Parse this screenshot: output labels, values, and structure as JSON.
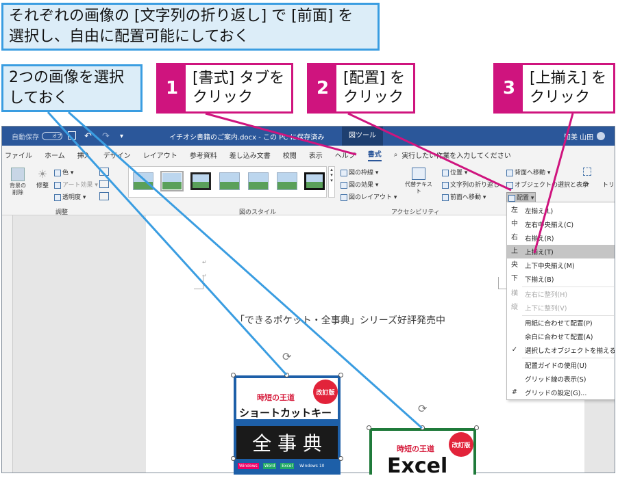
{
  "callouts": {
    "top": {
      "line1": "それぞれの画像の [文字列の折り返し] で [前面] を",
      "line2": "選択し、自由に配置可能にしておく"
    },
    "left": {
      "line1": "2つの画像を選択",
      "line2": "しておく"
    }
  },
  "steps": [
    {
      "num": "1",
      "line1": "[書式] タブを",
      "line2": "クリック"
    },
    {
      "num": "2",
      "line1": "[配置] を",
      "line2": "クリック"
    },
    {
      "num": "3",
      "line1": "[上揃え] を",
      "line2": "クリック"
    }
  ],
  "titlebar": {
    "autosave": "自動保存",
    "autosave_state": "オフ",
    "doc_title": "イチオシ書籍のご案内.docx - この PC に保存済み",
    "context_tab": "図ツール",
    "user": "知美 山田"
  },
  "tabs": [
    "ファイル",
    "ホーム",
    "挿入",
    "デザイン",
    "レイアウト",
    "参考資料",
    "差し込み文書",
    "校閲",
    "表示",
    "ヘルプ",
    "書式"
  ],
  "tell_me": "実行したい作業を入力してください",
  "ribbon": {
    "adjust": {
      "remove_bg": "背景の削除",
      "corrections": "修整",
      "color": "色",
      "artistic": "アート効果",
      "transparency": "透明度",
      "group": "調整"
    },
    "styles": {
      "border": "図の枠線",
      "effects": "図の効果",
      "layout": "図のレイアウト",
      "group": "図のスタイル"
    },
    "access": {
      "alt_text": "代替テキスト",
      "group": "アクセシビリティ"
    },
    "arrange": {
      "position": "位置",
      "wrap": "文字列の折り返し",
      "forward": "前面へ移動",
      "backward": "背面へ移動",
      "selection_pane": "オブジェクトの選択と表示",
      "align": "配置"
    },
    "size": {
      "crop": "トリミ"
    }
  },
  "align_menu": [
    {
      "icon": "左",
      "label": "左揃え(L)",
      "state": "normal"
    },
    {
      "icon": "中",
      "label": "左右中央揃え(C)",
      "state": "normal"
    },
    {
      "icon": "右",
      "label": "右揃え(R)",
      "state": "normal"
    },
    {
      "icon": "上",
      "label": "上揃え(T)",
      "state": "highlight"
    },
    {
      "icon": "央",
      "label": "上下中央揃え(M)",
      "state": "normal"
    },
    {
      "icon": "下",
      "label": "下揃え(B)",
      "state": "normal"
    },
    {
      "icon": "横",
      "label": "左右に整列(H)",
      "state": "disabled"
    },
    {
      "icon": "縦",
      "label": "上下に整列(V)",
      "state": "disabled"
    },
    {
      "icon": "",
      "label": "用紙に合わせて配置(P)",
      "state": "normal"
    },
    {
      "icon": "",
      "label": "余白に合わせて配置(A)",
      "state": "normal"
    },
    {
      "icon": "✓",
      "label": "選択したオブジェクトを揃える(O)",
      "state": "normal"
    },
    {
      "icon": "",
      "label": "配置ガイドの使用(U)",
      "state": "normal"
    },
    {
      "icon": "",
      "label": "グリッド線の表示(S)",
      "state": "normal"
    },
    {
      "icon": "#",
      "label": "グリッドの設定(G)...",
      "state": "normal"
    }
  ],
  "document": {
    "heading": "「できるポケット・全事典」シリーズ好評発売中"
  },
  "book1": {
    "badge": "改訂版",
    "series": "時短の王道",
    "title": "ショートカットキー",
    "big": "全 事 典",
    "tags": [
      "Windows",
      "Word",
      "Excel",
      "Windows 10"
    ]
  },
  "book2": {
    "badge": "改訂版",
    "series": "時短の王道",
    "title": "Excel"
  },
  "colors": {
    "accent_blue": "#3a9de1",
    "accent_pink": "#cf147e",
    "word_blue": "#2b579a"
  }
}
